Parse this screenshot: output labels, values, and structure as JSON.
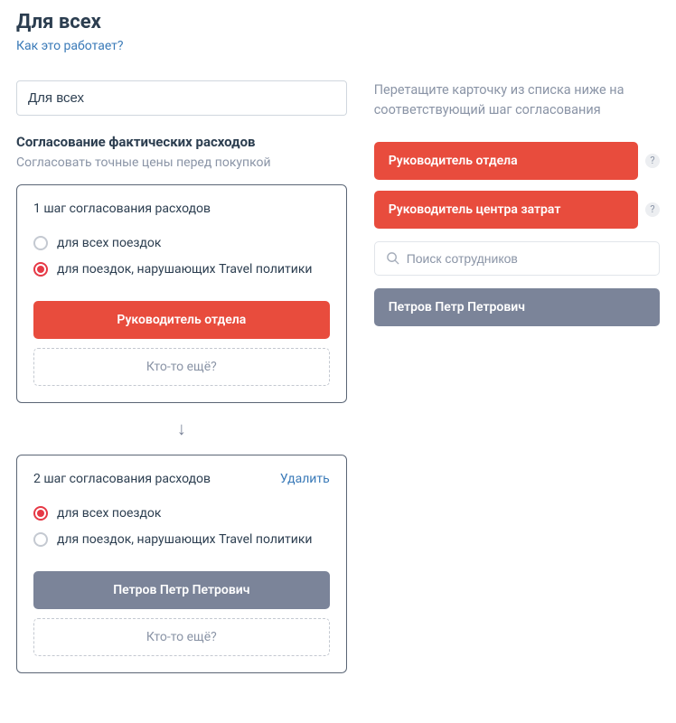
{
  "header": {
    "title": "Для всех",
    "how_link": "Как это работает?"
  },
  "left": {
    "name_value": "Для всех",
    "section_title": "Согласование фактических расходов",
    "section_sub": "Согласовать точные цены перед покупкой",
    "steps": [
      {
        "title": "1 шаг согласования расходов",
        "delete": "",
        "radio_all": "для всех поездок",
        "radio_violating": "для поездок, нарушающих Travel политики",
        "selected": "violating",
        "approver": "Руководитель отдела",
        "approver_color": "red",
        "add_more": "Кто-то ещё?"
      },
      {
        "title": "2 шаг согласования расходов",
        "delete": "Удалить",
        "radio_all": "для всех поездок",
        "radio_violating": "для поездок, нарушающих Travel политики",
        "selected": "all",
        "approver": "Петров Петр Петрович",
        "approver_color": "slate",
        "add_more": "Кто-то ещё?"
      }
    ],
    "arrow": "↓"
  },
  "right": {
    "drag_hint": "Перетащите карточку из списка ниже на соответствующий шаг согласования",
    "role_chips": [
      "Руководитель отдела",
      "Руководитель центра затрат"
    ],
    "search_placeholder": "Поиск сотрудников",
    "person": "Петров Петр Петрович"
  }
}
